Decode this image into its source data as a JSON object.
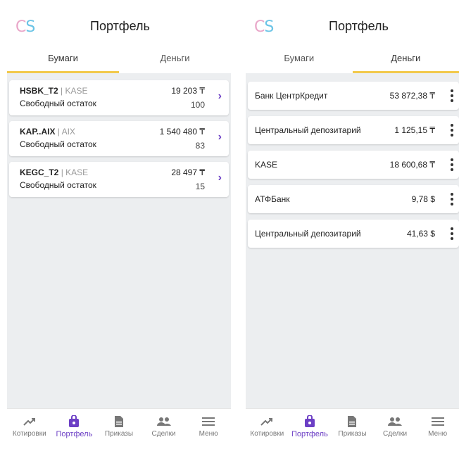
{
  "app": {
    "logo_c": "C",
    "logo_s": "S",
    "title": "Портфель",
    "accent": "#6c3fc5",
    "tab_indicator": "#f2c94c"
  },
  "tabs": [
    {
      "label": "Бумаги"
    },
    {
      "label": "Деньги"
    }
  ],
  "securities": [
    {
      "ticker": "HSBK_T2",
      "sep": " | ",
      "exchange": "KASE",
      "subtitle": "Свободный остаток",
      "price": "19 203 ₸",
      "qty": "100"
    },
    {
      "ticker": "KAP..AIX",
      "sep": " | ",
      "exchange": "AIX",
      "subtitle": "Свободный остаток",
      "price": "1 540 480 ₸",
      "qty": "83"
    },
    {
      "ticker": "KEGC_T2",
      "sep": " | ",
      "exchange": "KASE",
      "subtitle": "Свободный остаток",
      "price": "28 497 ₸",
      "qty": "15"
    }
  ],
  "money": [
    {
      "name": "Банк ЦентрКредит",
      "value": "53 872,38 ₸"
    },
    {
      "name": "Центральный депозитарий",
      "value": "1 125,15 ₸"
    },
    {
      "name": "KASE",
      "value": "18 600,68 ₸"
    },
    {
      "name": "АТФБанк",
      "value": "9,78 $"
    },
    {
      "name": "Центральный депозитарий",
      "value": "41,63 $"
    }
  ],
  "bottom_nav": [
    {
      "label": "Котировки",
      "icon": "trending-up-icon"
    },
    {
      "label": "Портфель",
      "icon": "briefcase-icon"
    },
    {
      "label": "Приказы",
      "icon": "document-icon"
    },
    {
      "label": "Сделки",
      "icon": "people-icon"
    },
    {
      "label": "Меню",
      "icon": "hamburger-menu-icon"
    }
  ]
}
